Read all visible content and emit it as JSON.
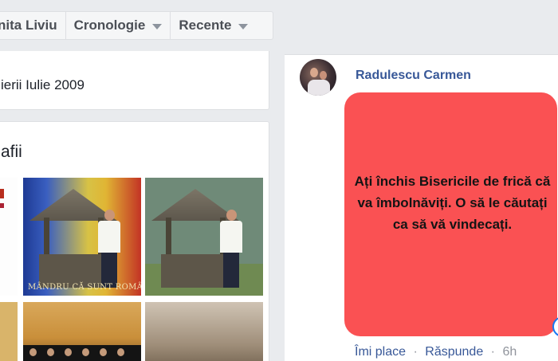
{
  "navbar": {
    "items": [
      {
        "label": "nita Liviu"
      },
      {
        "label": "Cronologie"
      },
      {
        "label": "Recente"
      }
    ]
  },
  "intro": {
    "text": "ierii Iulie 2009"
  },
  "photos": {
    "title": "afii",
    "caption": "MÂNDRU CĂ SUNT ROMÂN"
  },
  "comment": {
    "author": "Radulescu Carmen",
    "body": "Ați închis Bisericile de frică că va îmbolnăviți. O să le căutați ca să vă vindecați.",
    "actions": {
      "like": "Îmi place",
      "reply": "Răspunde",
      "separator": "·",
      "time": "6h"
    }
  },
  "colors": {
    "post_background": "#fa5153",
    "link": "#385898",
    "page_background": "#e9ebee"
  }
}
